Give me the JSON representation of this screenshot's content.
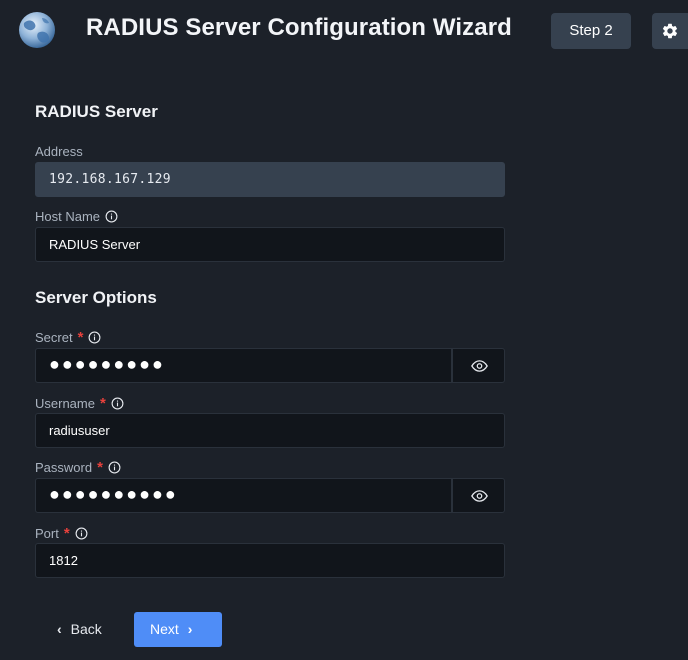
{
  "header": {
    "title": "RADIUS Server Configuration Wizard",
    "step_label": "Step 2",
    "logo_icon": "globe-icon",
    "settings_icon": "gear-icon"
  },
  "radius_server": {
    "section_title": "RADIUS Server",
    "address": {
      "label": "Address",
      "value": "192.168.167.129"
    },
    "host_name": {
      "label": "Host Name",
      "value": "RADIUS Server"
    }
  },
  "server_options": {
    "section_title": "Server Options",
    "secret": {
      "label": "Secret",
      "required_mark": "*",
      "value": "●●●●●●●●●",
      "toggle_icon": "eye-icon"
    },
    "username": {
      "label": "Username",
      "required_mark": "*",
      "value": "radiususer"
    },
    "password": {
      "label": "Password",
      "required_mark": "*",
      "value": "●●●●●●●●●●",
      "toggle_icon": "eye-icon"
    },
    "port": {
      "label": "Port",
      "required_mark": "*",
      "value": "1812"
    }
  },
  "footer": {
    "back_label": "Back",
    "next_label": "Next"
  },
  "colors": {
    "background": "#1c2129",
    "input_bg": "#11151b",
    "readonly_bg": "#36414f",
    "accent": "#4f8df7",
    "required": "#e8413c"
  }
}
